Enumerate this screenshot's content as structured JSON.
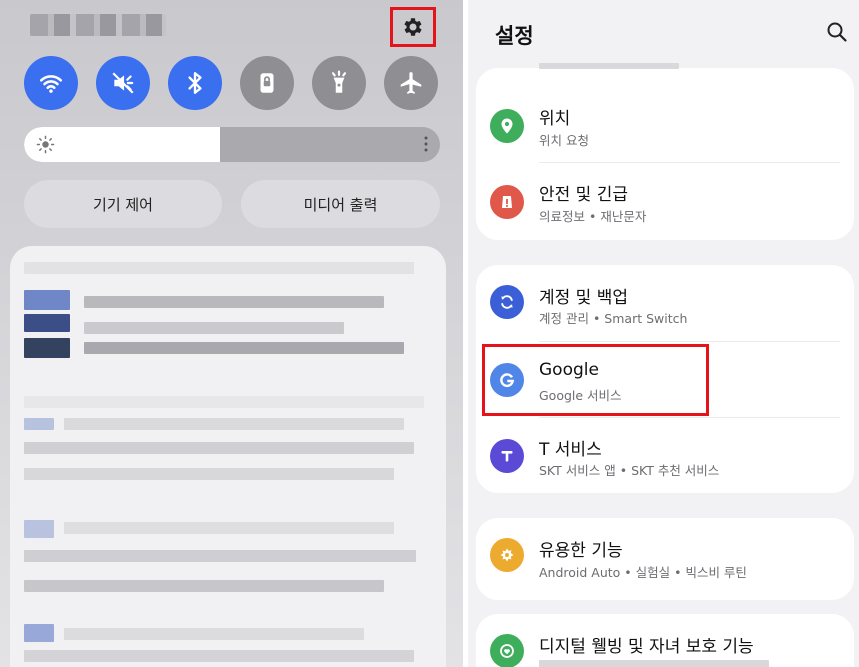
{
  "quick_panel": {
    "settings_icon": "gear-icon",
    "tiles": [
      {
        "icon": "wifi-icon",
        "state": "on"
      },
      {
        "icon": "sound-mute-icon",
        "state": "on"
      },
      {
        "icon": "bluetooth-icon",
        "state": "on"
      },
      {
        "icon": "lock-screen-icon",
        "state": "off"
      },
      {
        "icon": "flashlight-icon",
        "state": "off"
      },
      {
        "icon": "airplane-icon",
        "state": "off"
      }
    ],
    "brightness_level": 0.47,
    "buttons": {
      "device_control": "기기 제어",
      "media_output": "미디어 출력"
    }
  },
  "settings": {
    "title": "설정",
    "search_icon": "search-icon",
    "items": [
      {
        "title": "위치",
        "subtitle": "위치 요청",
        "icon": "location-icon",
        "color": "#3fae5c"
      },
      {
        "title": "안전 및 긴급",
        "subtitle": "의료정보 • 재난문자",
        "icon": "emergency-icon",
        "color": "#e0584a"
      },
      {
        "title": "계정 및 백업",
        "subtitle": "계정 관리 • Smart Switch",
        "icon": "sync-icon",
        "color": "#3a5fd6"
      },
      {
        "title": "Google",
        "subtitle": "Google 서비스",
        "icon": "google-icon",
        "color": "#4f86e8"
      },
      {
        "title": "T 서비스",
        "subtitle": "SKT 서비스 앱 • SKT 추천 서비스",
        "icon": "t-service-icon",
        "color": "#5b4ad6"
      },
      {
        "title": "유용한 기능",
        "subtitle": "Android Auto • 실험실 • 빅스비 루틴",
        "icon": "puzzle-icon",
        "color": "#ecaa2e"
      },
      {
        "title": "디지털 웰빙 및 자녀 보호 기능",
        "subtitle": "",
        "icon": "wellbeing-icon",
        "color": "#3fae5c"
      }
    ]
  },
  "colors": {
    "accent_on": "#3a6ff0",
    "tile_off": "#8e8e93",
    "highlight": "#e5141b"
  }
}
